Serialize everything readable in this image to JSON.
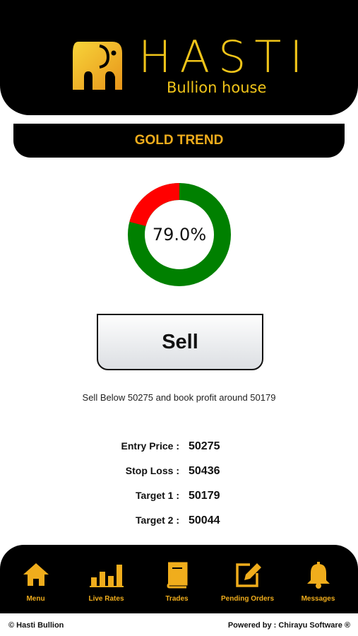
{
  "brand": {
    "name": "HASTI",
    "subtitle": "Bullion house"
  },
  "page": {
    "title": "GOLD TREND"
  },
  "trend": {
    "percent_label": "79.0%",
    "green_fraction": 0.79,
    "red_fraction": 0.21,
    "colors": {
      "green": "#008000",
      "red": "#ff0000"
    }
  },
  "action": {
    "label": "Sell"
  },
  "advice": "Sell Below 50275 and book profit around 50179",
  "stats": [
    {
      "label": "Entry Price :",
      "value": "50275"
    },
    {
      "label": "Stop Loss :",
      "value": "50436"
    },
    {
      "label": "Target 1 :",
      "value": "50179"
    },
    {
      "label": "Target 2 :",
      "value": "50044"
    }
  ],
  "nav": [
    {
      "label": "Menu",
      "icon": "home-icon"
    },
    {
      "label": "Live Rates",
      "icon": "bar-chart-icon"
    },
    {
      "label": "Trades",
      "icon": "book-icon"
    },
    {
      "label": "Pending Orders",
      "icon": "edit-icon"
    },
    {
      "label": "Messages",
      "icon": "bell-icon"
    }
  ],
  "footer": {
    "left": "© Hasti Bullion",
    "right": "Powered by : Chirayu Software ®"
  },
  "theme": {
    "accent": "#f0ad1c",
    "header_bg": "#000000"
  }
}
